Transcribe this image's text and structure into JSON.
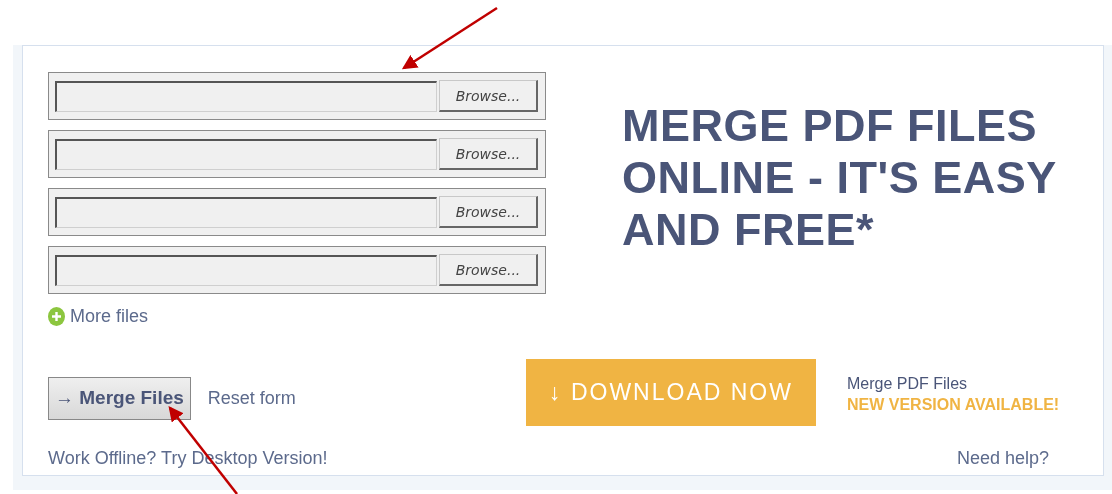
{
  "file_rows": [
    {
      "browse_label": "Browse..."
    },
    {
      "browse_label": "Browse..."
    },
    {
      "browse_label": "Browse..."
    },
    {
      "browse_label": "Browse..."
    }
  ],
  "more_files": "More files",
  "merge_button": "→ Merge Files",
  "reset_link": "Reset form",
  "offline_link": "Work Offline? Try Desktop Version!",
  "headline": "MERGE PDF FILES ONLINE - IT'S EASY AND FREE*",
  "download_button": "↓ DOWNLOAD NOW",
  "promo_title": "Merge PDF Files",
  "promo_badge": "NEW VERSION AVAILABLE!",
  "help_link": "Need help?"
}
